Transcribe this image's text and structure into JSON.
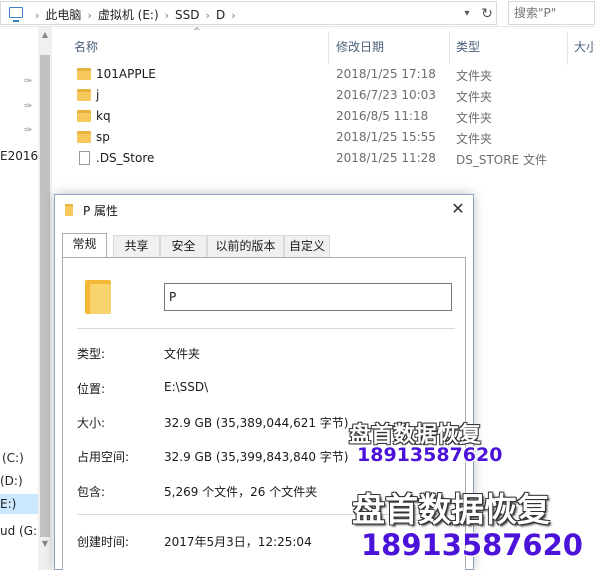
{
  "address_bar": {
    "breadcrumbs": [
      "此电脑",
      "虚拟机 (E:)",
      "SSD",
      "D"
    ],
    "search_placeholder": "搜索\"P\""
  },
  "nav": {
    "labels": {
      "e2016": "E2016.",
      "c_drive": "(C:)",
      "d_drive": "(D:)",
      "e_drive": "E:)",
      "g_drive": "ud (G:)"
    }
  },
  "file_list": {
    "columns": {
      "name": "名称",
      "date": "修改日期",
      "type": "类型",
      "size": "大小"
    },
    "rows": [
      {
        "name": "101APPLE",
        "date": "2018/1/25 17:18",
        "type": "文件夹",
        "icon": "folder-icon"
      },
      {
        "name": "j",
        "date": "2016/7/23 10:03",
        "type": "文件夹",
        "icon": "folder-icon"
      },
      {
        "name": "kq",
        "date": "2016/8/5 11:18",
        "type": "文件夹",
        "icon": "folder-icon"
      },
      {
        "name": "sp",
        "date": "2018/1/25 15:55",
        "type": "文件夹",
        "icon": "folder-icon"
      },
      {
        "name": ".DS_Store",
        "date": "2018/1/25 11:28",
        "type": "DS_STORE 文件",
        "icon": "file-icon"
      }
    ]
  },
  "dialog": {
    "title": "P 属性",
    "tabs": [
      "常规",
      "共享",
      "安全",
      "以前的版本",
      "自定义"
    ],
    "active_tab": "常规",
    "name_value": "P",
    "props": {
      "type_label": "类型:",
      "type_value": "文件夹",
      "location_label": "位置:",
      "location_value": "E:\\SSD\\",
      "size_label": "大小:",
      "size_value": "32.9 GB (35,389,044,621 字节)",
      "disk_label": "占用空间:",
      "disk_value": "32.9 GB (35,399,843,840 字节)",
      "contains_label": "包含:",
      "contains_value": "5,269 个文件，26 个文件夹",
      "created_label": "创建时间:",
      "created_value": "2017年5月3日，12:25:04"
    }
  },
  "watermark": {
    "title": "盘首数据恢复",
    "phone": "18913587620"
  },
  "colors": {
    "folder": "#f7c95c",
    "selection": "#cce8ff",
    "watermark_phone": "#4b12d9",
    "column_header": "#4c607a"
  }
}
